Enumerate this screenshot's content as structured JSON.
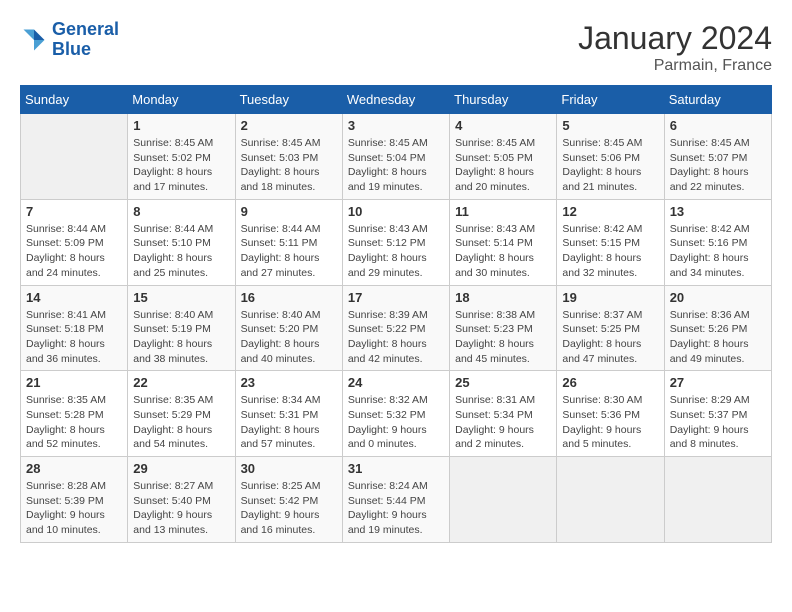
{
  "header": {
    "logo_text_general": "General",
    "logo_text_blue": "Blue",
    "month_year": "January 2024",
    "location": "Parmain, France"
  },
  "weekdays": [
    "Sunday",
    "Monday",
    "Tuesday",
    "Wednesday",
    "Thursday",
    "Friday",
    "Saturday"
  ],
  "weeks": [
    [
      {
        "day": "",
        "sunrise": "",
        "sunset": "",
        "daylight": ""
      },
      {
        "day": "1",
        "sunrise": "Sunrise: 8:45 AM",
        "sunset": "Sunset: 5:02 PM",
        "daylight": "Daylight: 8 hours and 17 minutes."
      },
      {
        "day": "2",
        "sunrise": "Sunrise: 8:45 AM",
        "sunset": "Sunset: 5:03 PM",
        "daylight": "Daylight: 8 hours and 18 minutes."
      },
      {
        "day": "3",
        "sunrise": "Sunrise: 8:45 AM",
        "sunset": "Sunset: 5:04 PM",
        "daylight": "Daylight: 8 hours and 19 minutes."
      },
      {
        "day": "4",
        "sunrise": "Sunrise: 8:45 AM",
        "sunset": "Sunset: 5:05 PM",
        "daylight": "Daylight: 8 hours and 20 minutes."
      },
      {
        "day": "5",
        "sunrise": "Sunrise: 8:45 AM",
        "sunset": "Sunset: 5:06 PM",
        "daylight": "Daylight: 8 hours and 21 minutes."
      },
      {
        "day": "6",
        "sunrise": "Sunrise: 8:45 AM",
        "sunset": "Sunset: 5:07 PM",
        "daylight": "Daylight: 8 hours and 22 minutes."
      }
    ],
    [
      {
        "day": "7",
        "sunrise": "Sunrise: 8:44 AM",
        "sunset": "Sunset: 5:09 PM",
        "daylight": "Daylight: 8 hours and 24 minutes."
      },
      {
        "day": "8",
        "sunrise": "Sunrise: 8:44 AM",
        "sunset": "Sunset: 5:10 PM",
        "daylight": "Daylight: 8 hours and 25 minutes."
      },
      {
        "day": "9",
        "sunrise": "Sunrise: 8:44 AM",
        "sunset": "Sunset: 5:11 PM",
        "daylight": "Daylight: 8 hours and 27 minutes."
      },
      {
        "day": "10",
        "sunrise": "Sunrise: 8:43 AM",
        "sunset": "Sunset: 5:12 PM",
        "daylight": "Daylight: 8 hours and 29 minutes."
      },
      {
        "day": "11",
        "sunrise": "Sunrise: 8:43 AM",
        "sunset": "Sunset: 5:14 PM",
        "daylight": "Daylight: 8 hours and 30 minutes."
      },
      {
        "day": "12",
        "sunrise": "Sunrise: 8:42 AM",
        "sunset": "Sunset: 5:15 PM",
        "daylight": "Daylight: 8 hours and 32 minutes."
      },
      {
        "day": "13",
        "sunrise": "Sunrise: 8:42 AM",
        "sunset": "Sunset: 5:16 PM",
        "daylight": "Daylight: 8 hours and 34 minutes."
      }
    ],
    [
      {
        "day": "14",
        "sunrise": "Sunrise: 8:41 AM",
        "sunset": "Sunset: 5:18 PM",
        "daylight": "Daylight: 8 hours and 36 minutes."
      },
      {
        "day": "15",
        "sunrise": "Sunrise: 8:40 AM",
        "sunset": "Sunset: 5:19 PM",
        "daylight": "Daylight: 8 hours and 38 minutes."
      },
      {
        "day": "16",
        "sunrise": "Sunrise: 8:40 AM",
        "sunset": "Sunset: 5:20 PM",
        "daylight": "Daylight: 8 hours and 40 minutes."
      },
      {
        "day": "17",
        "sunrise": "Sunrise: 8:39 AM",
        "sunset": "Sunset: 5:22 PM",
        "daylight": "Daylight: 8 hours and 42 minutes."
      },
      {
        "day": "18",
        "sunrise": "Sunrise: 8:38 AM",
        "sunset": "Sunset: 5:23 PM",
        "daylight": "Daylight: 8 hours and 45 minutes."
      },
      {
        "day": "19",
        "sunrise": "Sunrise: 8:37 AM",
        "sunset": "Sunset: 5:25 PM",
        "daylight": "Daylight: 8 hours and 47 minutes."
      },
      {
        "day": "20",
        "sunrise": "Sunrise: 8:36 AM",
        "sunset": "Sunset: 5:26 PM",
        "daylight": "Daylight: 8 hours and 49 minutes."
      }
    ],
    [
      {
        "day": "21",
        "sunrise": "Sunrise: 8:35 AM",
        "sunset": "Sunset: 5:28 PM",
        "daylight": "Daylight: 8 hours and 52 minutes."
      },
      {
        "day": "22",
        "sunrise": "Sunrise: 8:35 AM",
        "sunset": "Sunset: 5:29 PM",
        "daylight": "Daylight: 8 hours and 54 minutes."
      },
      {
        "day": "23",
        "sunrise": "Sunrise: 8:34 AM",
        "sunset": "Sunset: 5:31 PM",
        "daylight": "Daylight: 8 hours and 57 minutes."
      },
      {
        "day": "24",
        "sunrise": "Sunrise: 8:32 AM",
        "sunset": "Sunset: 5:32 PM",
        "daylight": "Daylight: 9 hours and 0 minutes."
      },
      {
        "day": "25",
        "sunrise": "Sunrise: 8:31 AM",
        "sunset": "Sunset: 5:34 PM",
        "daylight": "Daylight: 9 hours and 2 minutes."
      },
      {
        "day": "26",
        "sunrise": "Sunrise: 8:30 AM",
        "sunset": "Sunset: 5:36 PM",
        "daylight": "Daylight: 9 hours and 5 minutes."
      },
      {
        "day": "27",
        "sunrise": "Sunrise: 8:29 AM",
        "sunset": "Sunset: 5:37 PM",
        "daylight": "Daylight: 9 hours and 8 minutes."
      }
    ],
    [
      {
        "day": "28",
        "sunrise": "Sunrise: 8:28 AM",
        "sunset": "Sunset: 5:39 PM",
        "daylight": "Daylight: 9 hours and 10 minutes."
      },
      {
        "day": "29",
        "sunrise": "Sunrise: 8:27 AM",
        "sunset": "Sunset: 5:40 PM",
        "daylight": "Daylight: 9 hours and 13 minutes."
      },
      {
        "day": "30",
        "sunrise": "Sunrise: 8:25 AM",
        "sunset": "Sunset: 5:42 PM",
        "daylight": "Daylight: 9 hours and 16 minutes."
      },
      {
        "day": "31",
        "sunrise": "Sunrise: 8:24 AM",
        "sunset": "Sunset: 5:44 PM",
        "daylight": "Daylight: 9 hours and 19 minutes."
      },
      {
        "day": "",
        "sunrise": "",
        "sunset": "",
        "daylight": ""
      },
      {
        "day": "",
        "sunrise": "",
        "sunset": "",
        "daylight": ""
      },
      {
        "day": "",
        "sunrise": "",
        "sunset": "",
        "daylight": ""
      }
    ]
  ]
}
